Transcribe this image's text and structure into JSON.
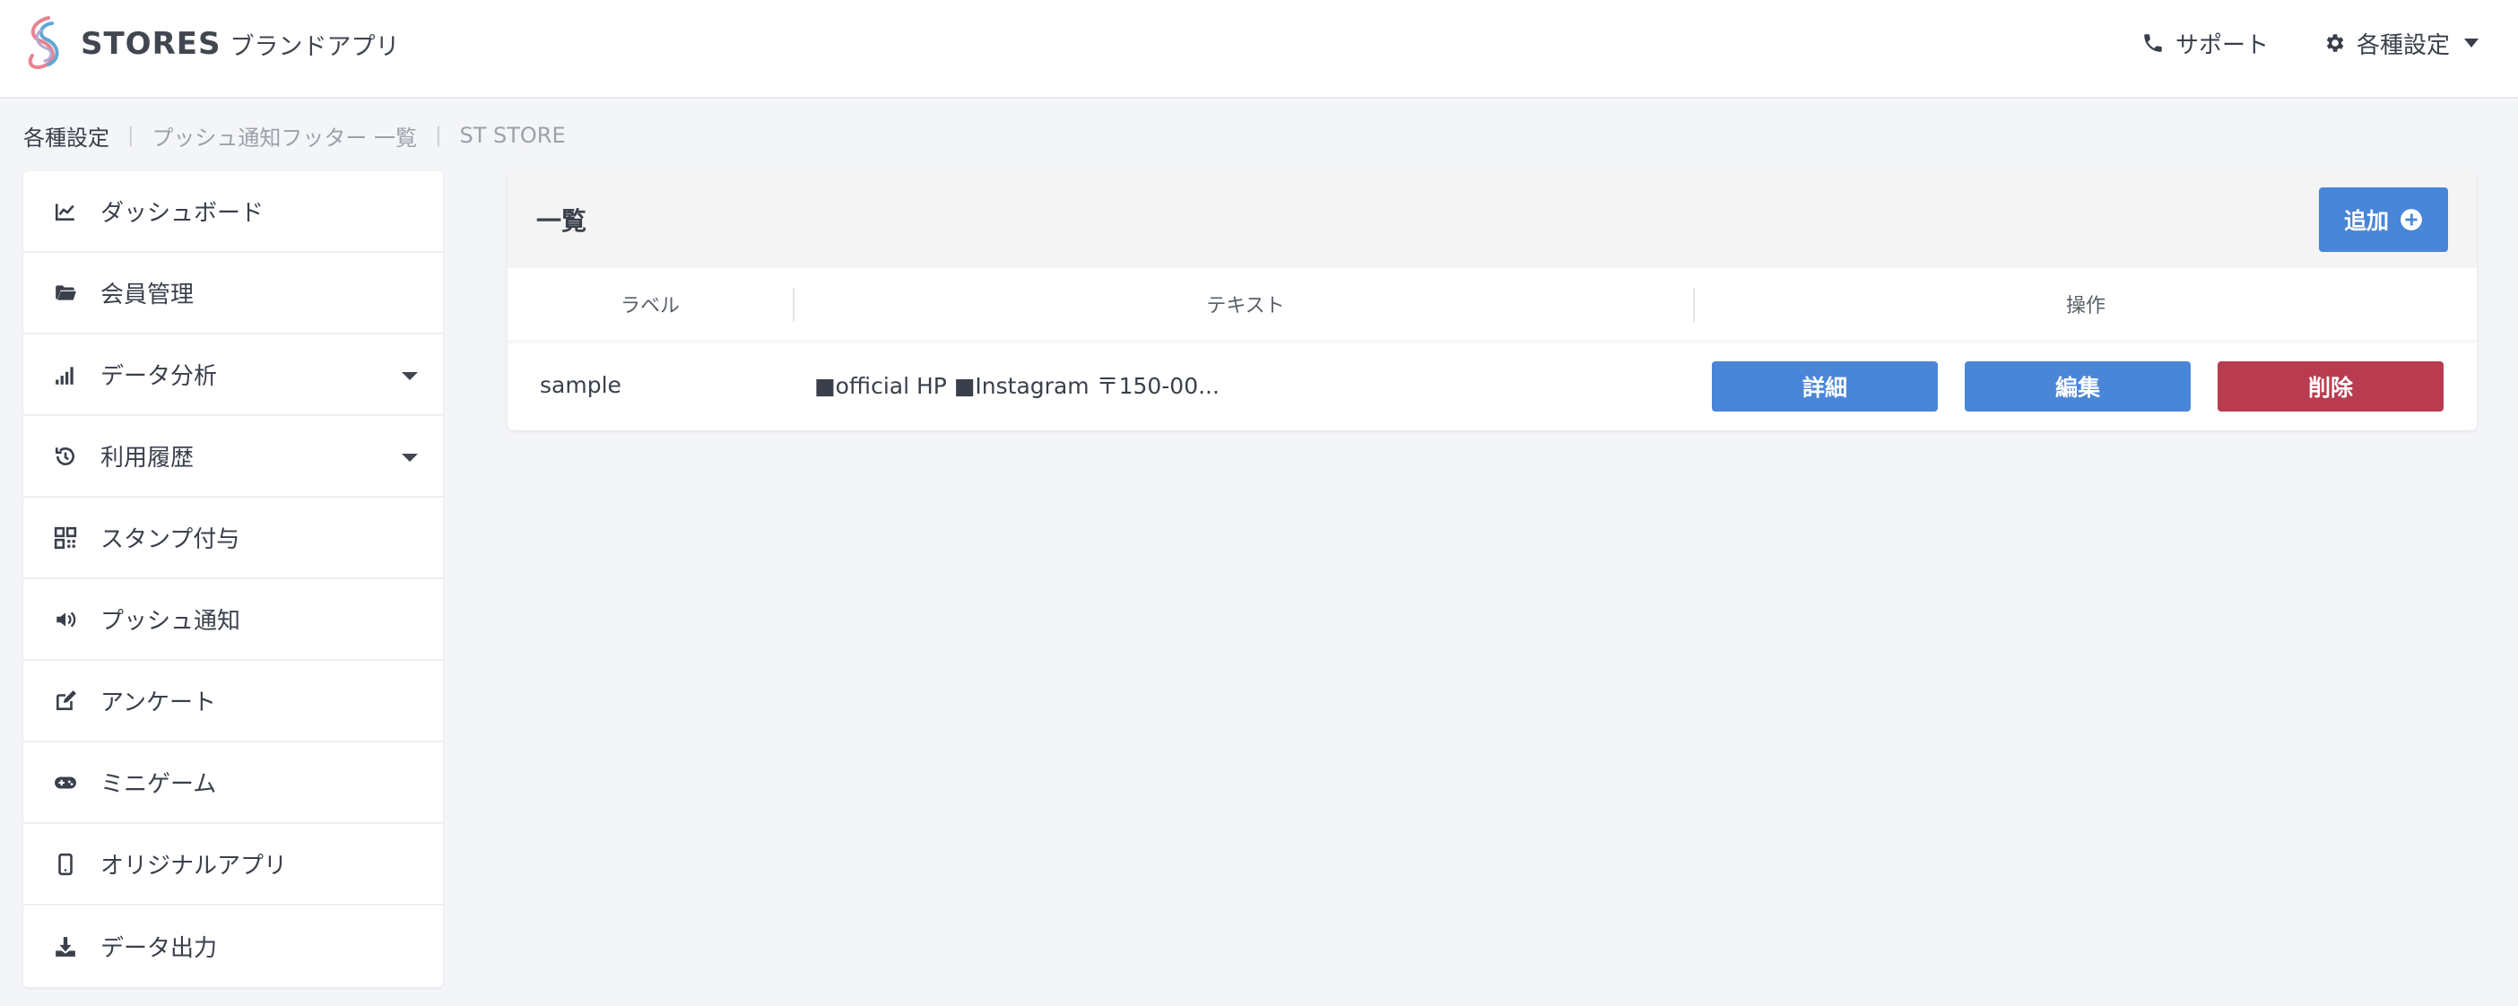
{
  "header": {
    "logo_text": "STORES",
    "logo_sub": "ブランドアプリ",
    "support_label": "サポート",
    "settings_label": "各種設定"
  },
  "breadcrumb": {
    "items": [
      "各種設定",
      "プッシュ通知フッター 一覧",
      "ST STORE"
    ]
  },
  "sidebar": {
    "items": [
      {
        "label": "ダッシュボード",
        "icon": "chart-line-icon"
      },
      {
        "label": "会員管理",
        "icon": "folder-open-icon"
      },
      {
        "label": "データ分析",
        "icon": "signal-bars-icon",
        "expandable": true
      },
      {
        "label": "利用履歴",
        "icon": "history-icon",
        "expandable": true
      },
      {
        "label": "スタンプ付与",
        "icon": "qrcode-icon"
      },
      {
        "label": "プッシュ通知",
        "icon": "volume-icon"
      },
      {
        "label": "アンケート",
        "icon": "edit-icon"
      },
      {
        "label": "ミニゲーム",
        "icon": "gamepad-icon"
      },
      {
        "label": "オリジナルアプリ",
        "icon": "mobile-icon"
      },
      {
        "label": "データ出力",
        "icon": "download-icon"
      }
    ]
  },
  "main": {
    "title": "一覧",
    "add_label": "追加",
    "columns": [
      "ラベル",
      "テキスト",
      "操作"
    ],
    "rows": [
      {
        "label": "sample",
        "text": "■official HP ■Instagram 〒150-00...",
        "actions": [
          "詳細",
          "編集",
          "削除"
        ]
      }
    ]
  },
  "colors": {
    "primary": "#4a86d8",
    "danger": "#b83b4f",
    "background": "#f4f5f8"
  }
}
